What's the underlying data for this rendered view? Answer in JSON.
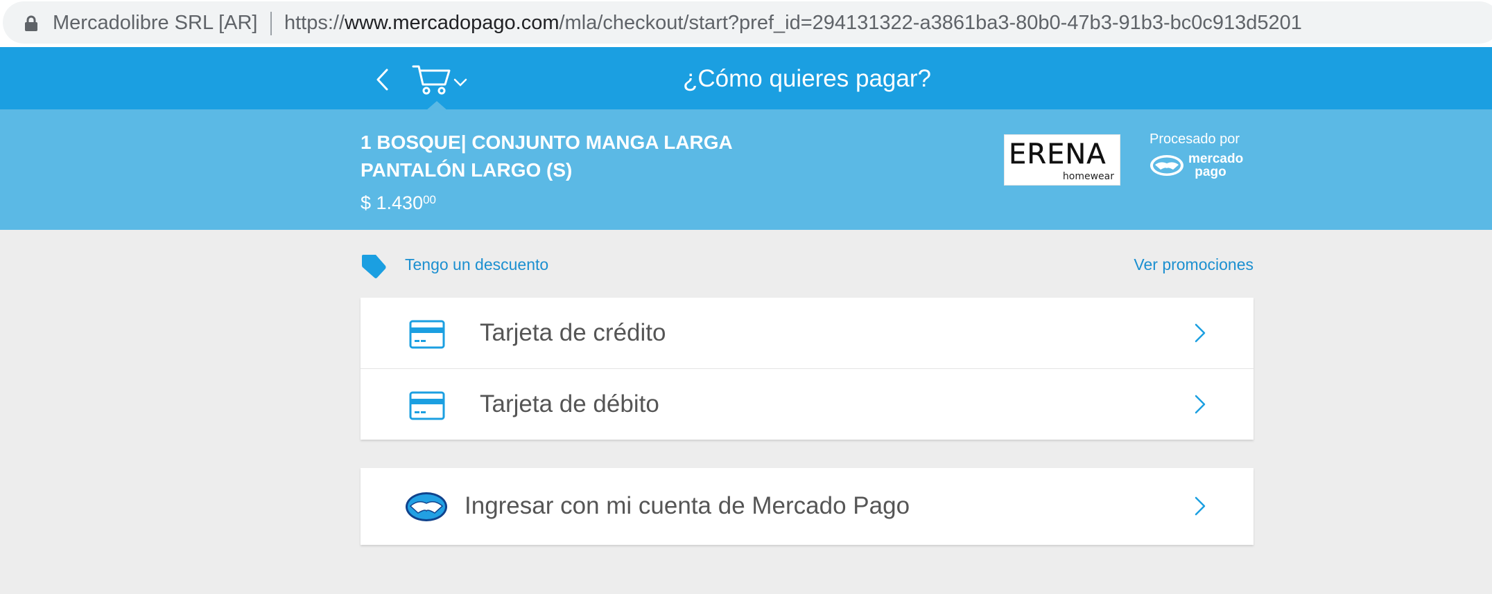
{
  "browser": {
    "site_identity": "Mercadolibre SRL [AR]",
    "url_scheme": "https://",
    "url_host": "www.mercadopago.com",
    "url_path": "/mla/checkout/start?pref_id=294131322-a3861ba3-80b0-47b3-91b3-bc0c913d5201"
  },
  "header": {
    "title": "¿Cómo quieres pagar?",
    "back_icon": "chevron-left-icon",
    "cart_icon": "shopping-cart-icon"
  },
  "summary": {
    "product_line1": "1 BOSQUE| CONJUNTO MANGA LARGA",
    "product_line2": "PANTALÓN LARGO (S)",
    "price_main": "$ 1.430",
    "price_cents": "00",
    "merchant_logo_word": "ERENA",
    "merchant_logo_sub": "homewear",
    "processed_by": "Procesado por",
    "processor_line1": "mercado",
    "processor_line2": "pago"
  },
  "discount": {
    "label": "Tengo un descuento",
    "promotions": "Ver promociones"
  },
  "payment_options": [
    {
      "label": "Tarjeta de crédito",
      "icon": "credit-card-icon"
    },
    {
      "label": "Tarjeta de débito",
      "icon": "debit-card-icon"
    },
    {
      "label": "Ingresar con mi cuenta de Mercado Pago",
      "icon": "mercadopago-logo-icon"
    }
  ],
  "colors": {
    "primary_blue": "#1b9fe1",
    "summary_blue": "#5bb9e5",
    "link_blue": "#1b8fd0",
    "background": "#ededed"
  }
}
